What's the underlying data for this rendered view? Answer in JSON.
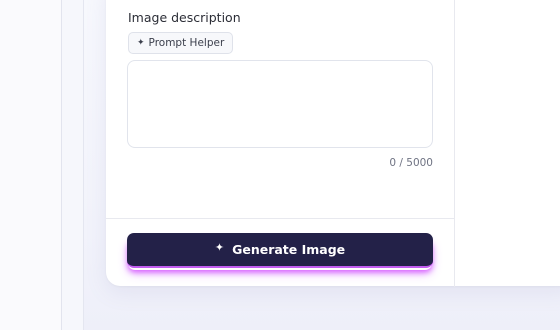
{
  "form": {
    "description_label": "Image description",
    "prompt_helper_label": "Prompt Helper",
    "description_value": "",
    "description_placeholder": "",
    "char_counter": "0 / 5000",
    "generate_label": "Generate Image"
  },
  "icons": {
    "prompt_helper_icon": "sparkle-icon",
    "generate_icon": "sparkle-icon"
  },
  "colors": {
    "generate_button_bg": "#232148",
    "generate_glow": "#d652ff",
    "page_bg": "#f1f2fb"
  }
}
